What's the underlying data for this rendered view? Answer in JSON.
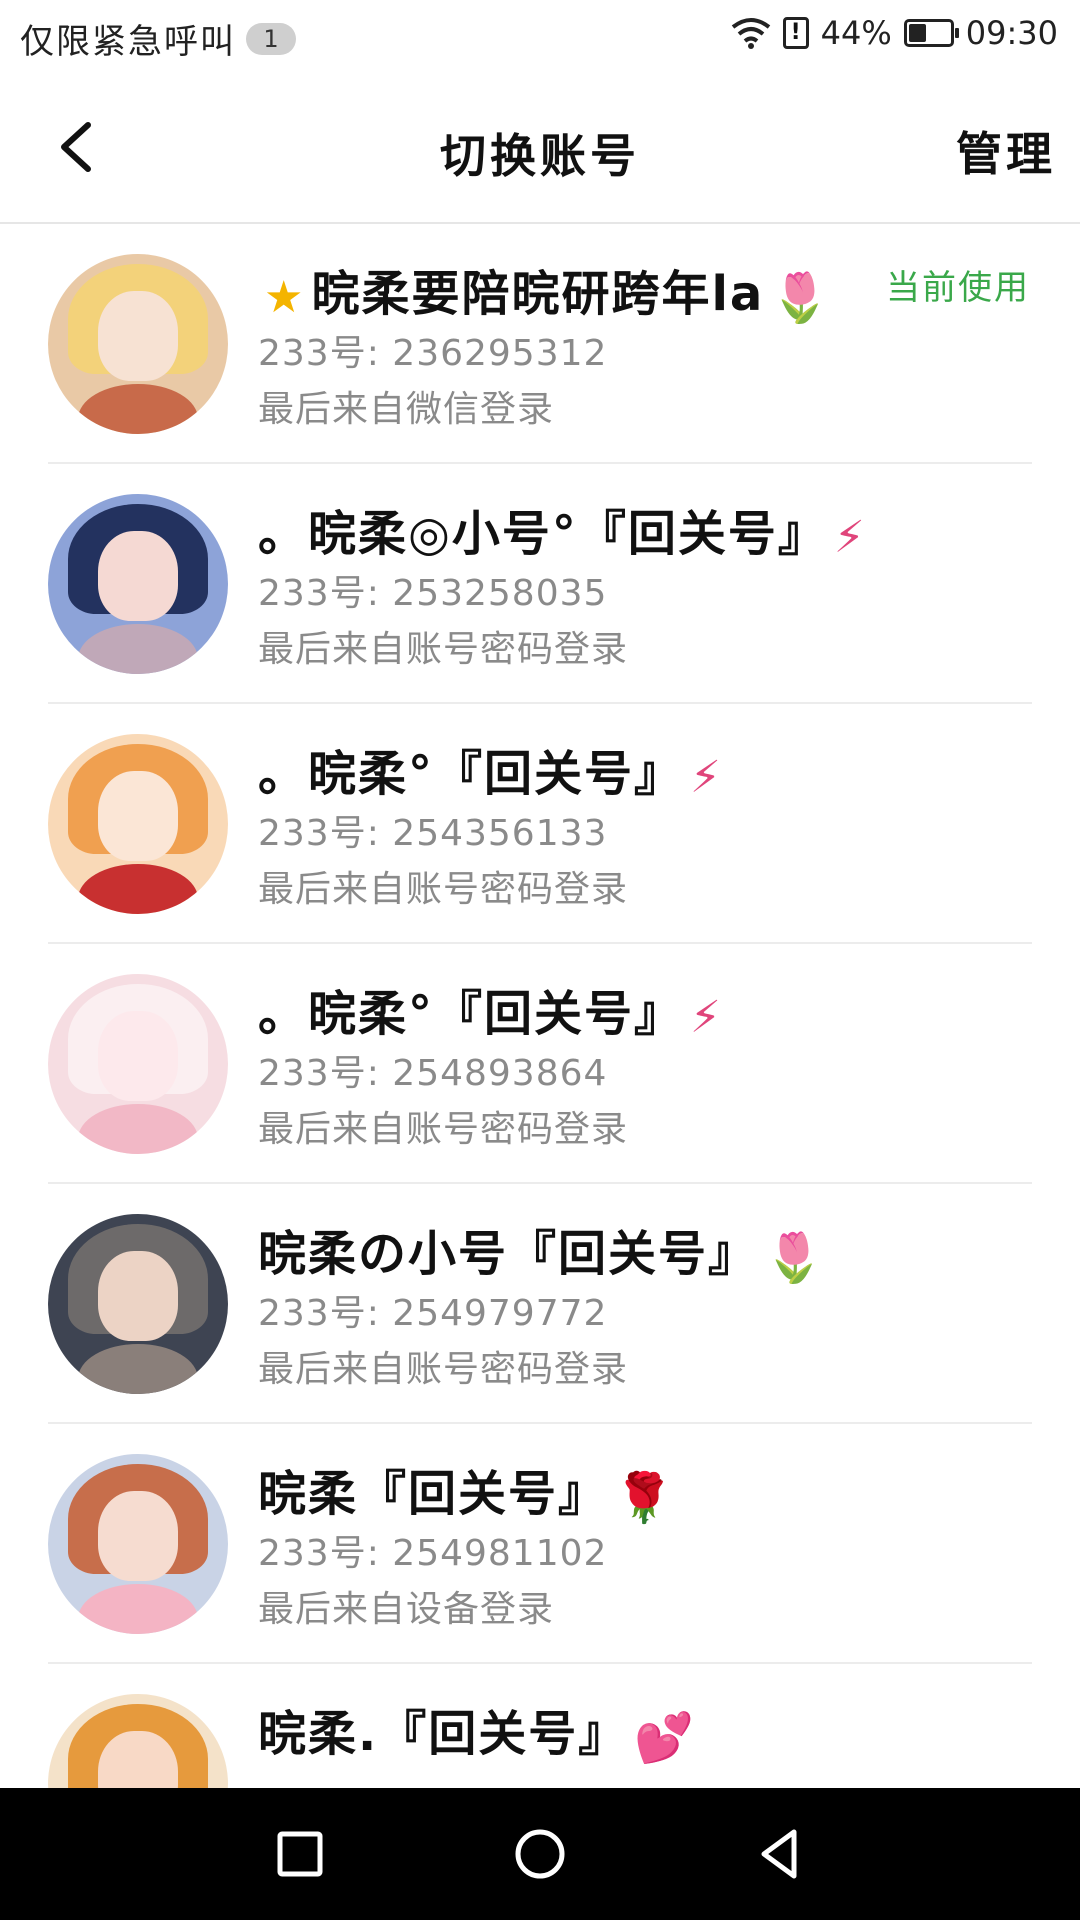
{
  "status_bar": {
    "carrier": "仅限紧急呼叫",
    "badge": "1",
    "battery": "44%",
    "battery_level": 0.44,
    "time": "09:30"
  },
  "header": {
    "title": "切换账号",
    "manage_label": "管理",
    "back_icon": "chevron-left-icon"
  },
  "accounts": [
    {
      "name": "晥柔要陪晥研跨年la",
      "id_line": "233号: 236295312",
      "login_line": "最后来自微信登录",
      "current_label": "当前使用",
      "avatar_colors": [
        "#f3d27a",
        "#f7e2d3",
        "#c86a4a"
      ]
    },
    {
      "name": "。晥柔◎小号°『回关号』",
      "id_line": "233号: 253258035",
      "login_line": "最后来自账号密码登录",
      "avatar_colors": [
        "#23325f",
        "#f5d9d3",
        "#8da3d8"
      ]
    },
    {
      "name": "。晥柔°『回关号』",
      "id_line": "233号: 254356133",
      "login_line": "最后来自账号密码登录",
      "avatar_colors": [
        "#f0a050",
        "#fbe6d6",
        "#c83030"
      ]
    },
    {
      "name": "。晥柔°『回关号』",
      "id_line": "233号: 254893864",
      "login_line": "最后来自账号密码登录",
      "avatar_colors": [
        "#f6dde2",
        "#fde9ec",
        "#f2b8c6"
      ]
    },
    {
      "name": "晥柔の小号『回关号』",
      "id_line": "233号: 254979772",
      "login_line": "最后来自账号密码登录",
      "avatar_colors": [
        "#6d6a6a",
        "#ecd3c5",
        "#8a7f7a"
      ]
    },
    {
      "name": "晥柔『回关号』",
      "id_line": "233号: 254981102",
      "login_line": "最后来自设备登录",
      "avatar_colors": [
        "#c76e4b",
        "#f6dcd0",
        "#f4b4c4"
      ]
    },
    {
      "name": "晥柔.『回关号』",
      "id_line": "",
      "login_line": "",
      "avatar_colors": [
        "#e69a3d",
        "#f8d9c6",
        "#6a8fd0"
      ]
    }
  ],
  "nav": {
    "recent_icon": "square-icon",
    "home_icon": "circle-icon",
    "back_icon": "triangle-back-icon"
  }
}
